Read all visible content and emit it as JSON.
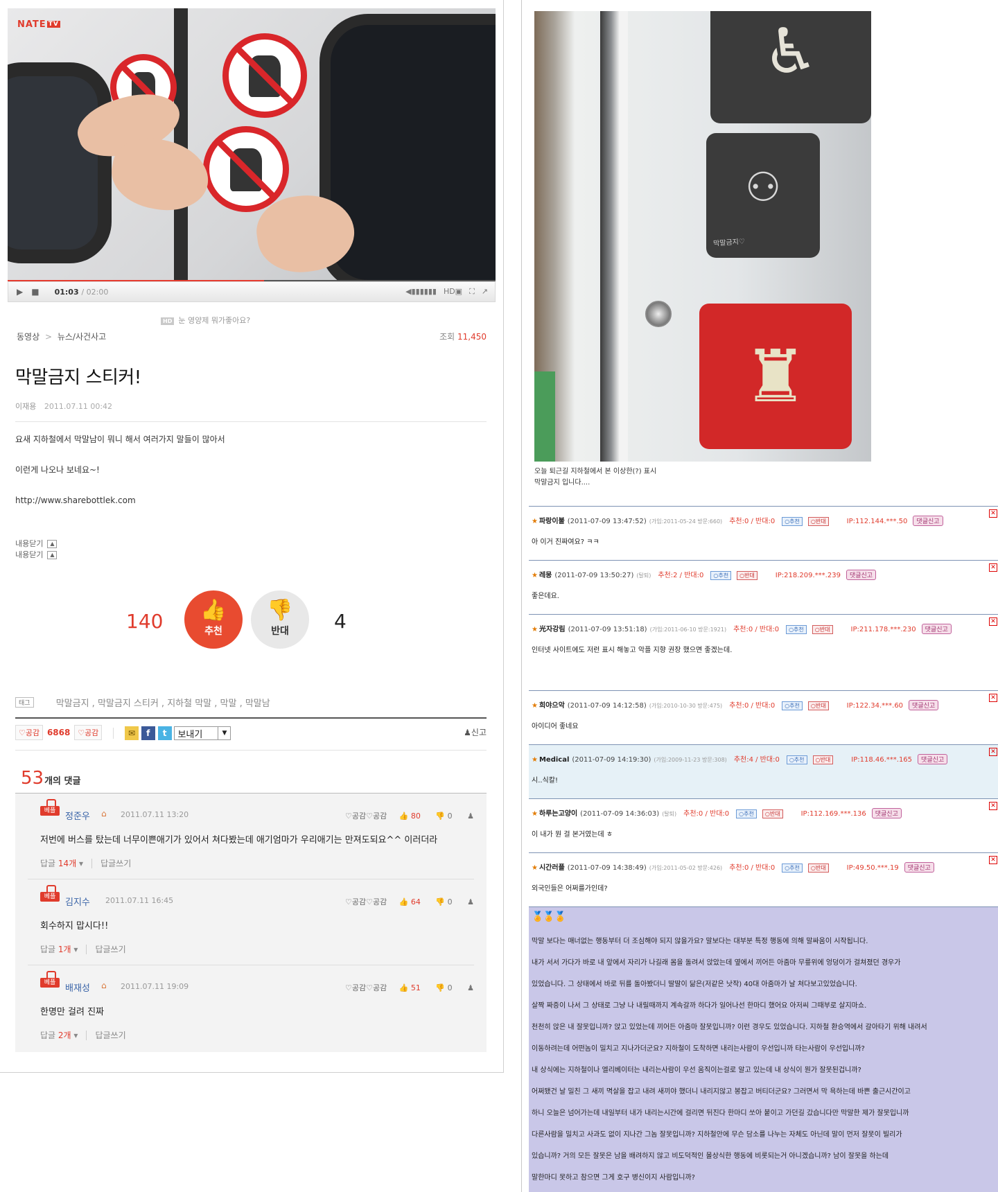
{
  "video": {
    "logo": "NATE",
    "logo_tv": "TV",
    "time_current": "01:03",
    "time_total": "/ 02:00",
    "progress": 0.525,
    "hd_badge": "HD",
    "hd_note": "눈 영양제 뭐가좋아요?"
  },
  "breadcrumb": {
    "root": "동영상",
    "separator": ">",
    "category": "뉴스/사건사고"
  },
  "views": {
    "label": "조회",
    "value": "11,450"
  },
  "post": {
    "title": "막말금지 스티커!",
    "author": "이재용",
    "date": "2011.07.11 00:42",
    "paragraphs": [
      "요새 지하철에서 막말남이 뭐니 해서 여러가지 말들이 많아서",
      "이런게 나오나 보네요~!",
      "http://www.sharebottlek.com"
    ],
    "fold_1": "내용닫기",
    "fold_2": "내용닫기"
  },
  "votes": {
    "up_count": "140",
    "up_label": "추천",
    "down_label": "반대",
    "down_count": "4"
  },
  "tags": {
    "badge": "태그",
    "text": "막말금지 , 막말금지 스티커 , 지하철 막말 , 막말 , 막말남"
  },
  "share": {
    "gong_label": "공감",
    "count": "6868",
    "gong_label_2": "공감",
    "send_label": "보내기",
    "report_label": "신고"
  },
  "comments_header": {
    "count": "53",
    "suffix": "개의 댓글"
  },
  "comments": [
    {
      "badge": "베플",
      "name": "정준우",
      "date": "2011.07.11 13:20",
      "gong1": "공감",
      "gong2": "공감",
      "up": "80",
      "down": "0",
      "text": "저번에 버스를 탔는데 너무이쁜애기가 있어서 쳐다봤는데 애기엄마가 우리애기는 만져도되요^^ 이러더라",
      "reply_label": "답글",
      "reply_count": "14개",
      "write_label": "답글쓰기"
    },
    {
      "badge": "베플",
      "name": "김지수",
      "date": "2011.07.11 16:45",
      "gong1": "공감",
      "gong2": "공감",
      "up": "64",
      "down": "0",
      "text": "회수하지 맙시다!!",
      "reply_label": "답글",
      "reply_count": "1개",
      "write_label": "답글쓰기"
    },
    {
      "badge": "베플",
      "name": "배재성",
      "date": "2011.07.11 19:09",
      "gong1": "공감",
      "gong2": "공감",
      "up": "51",
      "down": "0",
      "text": "한명만 걸려 진짜",
      "reply_label": "답글",
      "reply_count": "2개",
      "write_label": "답글쓰기"
    }
  ],
  "right_photo": {
    "sign_caption": "막말금지♡",
    "caption_line1": "오늘 퇴근길 지하철에서 본 이상한(?) 표시",
    "caption_line2": "막말금지 입니다...."
  },
  "board_comments": [
    {
      "name": "파랑이불",
      "ts": "(2011-07-09 13:47:52)",
      "meta": "(가입:2011-05-24 방문:660)",
      "score": "추천:0 / 반대:0",
      "ip": "IP:112.144.***.50",
      "btn_up": "추천",
      "btn_down": "반대",
      "report": "댓글신고",
      "text": "아 이거 진짜여요? ㅋㅋ"
    },
    {
      "name": "레몽",
      "ts": "(2011-07-09 13:50:27)",
      "meta": "(탈퇴)",
      "score": "추천:2 / 반대:0",
      "ip": "IP:218.209.***.239",
      "btn_up": "추천",
      "btn_down": "반대",
      "report": "댓글신고",
      "text": "좋은데요."
    },
    {
      "name": "光자강림",
      "ts": "(2011-07-09 13:51:18)",
      "meta": "(가입:2011-06-10 방문:1921)",
      "score": "추천:0 / 반대:0",
      "ip": "IP:211.178.***.230",
      "btn_up": "추천",
      "btn_down": "반대",
      "report": "댓글신고",
      "text": "인터넷 사이트에도 저런 표시 해놓고 악플 지향 권장 했으면 좋겠는데."
    },
    {
      "name": "희야으악",
      "ts": "(2011-07-09 14:12:58)",
      "meta": "(가입:2010-10-30 방문:475)",
      "score": "추천:0 / 반대:0",
      "ip": "IP:122.34.***.60",
      "btn_up": "추천",
      "btn_down": "반대",
      "report": "댓글신고",
      "text": "아이디어 좋네요"
    },
    {
      "name": "Medical",
      "ts": "(2011-07-09 14:19:30)",
      "meta": "(가입:2009-11-23 방문:308)",
      "score": "추천:4 / 반대:0",
      "ip": "IP:118.46.***.165",
      "btn_up": "추천",
      "btn_down": "반대",
      "report": "댓글신고",
      "text": "시..식칼!"
    },
    {
      "name": "하루는고양이",
      "ts": "(2011-07-09 14:36:03)",
      "meta": "(탈퇴)",
      "score": "추천:0 / 반대:0",
      "ip": "IP:112.169.***.136",
      "btn_up": "추천",
      "btn_down": "반대",
      "report": "댓글신고",
      "text": "이 내가 뭔 걸 본거였는데 ㅎ"
    },
    {
      "name": "시간러플",
      "ts": "(2011-07-09 14:38:49)",
      "meta": "(가입:2011-05-02 방문:426)",
      "score": "추천:0 / 반대:0",
      "ip": "IP:49.50.***.19",
      "btn_up": "추천",
      "btn_down": "반대",
      "report": "댓글신고",
      "text": "외국인들은 어쩌를가인데?"
    }
  ],
  "long_comment": {
    "lines": [
      "막말 보다는 매너없는 행동부터 더 조심해야 되지 않을가요? 말보다는 대부분 특정 행동에 의해 말싸움이 시작됩니다.",
      "내가 서서 가다가 바로 내 앞에서 자리가 나길래 몸을 돌려서 앉았는데 옆에서 끼어든 아줌마 무릎위에 엉덩이가 걸쳐졌던 경우가",
      "있었습니다. 그 상태에서 바로 뒤를 돌아봤더니 딸딸이 닮은(저같은 낫작) 40대 아줌마가 날 쳐다보고있었습니다.",
      "살짝 짜증이 나서 그 상태로 그냥 나 내릴때까지 계속갈까 하다가 일어나선 한마디 했어요 아저씨 그때부로 살지마쇼.",
      "천천히 앉은 내 잘못입니까? 앉고 있었는데 끼어든 아줌마 잘못입니까? 이런 경우도 있었습니다. 지하철 환승역에서 갈아타기 위해 내려서",
      "이동하려는데 어떤놈이 밀치고 지나가더군요? 지하철이 도착하면 내리는사람이 우선입니까 타는사람이 우선입니까?",
      "내 상식에는 지하철이나 엘리베이터는 내리는사람이 우선 움직이는걸로 알고 있는데 내 상식이 뭔가 잘못된겁니까?",
      "어쩌됐건 날 밀친 그 새끼 멱살을 잡고 내려 새끼야 했더니 내리지않고 봉잡고 버티더군요? 그러면서 막 욕하는데 바쁜 출근시간이고",
      "하니 오늘은 넘어가는데 내일부터 내가 내리는시간에 걸리면 뒤진다 한마디 쏘아 붙이고 가던길 갔습니다만 막말한 제가 잘못입니까",
      "다른사람을 밀치고 사과도 없이 지나간 그놈 잘못입니까? 지하철안에 무슨 담소를 나누는 자체도 아닌데 말이 먼저 잘못이 빌리가",
      "있습니까? 거의 모든 잘못은 남을 배려하지 않고 비도덕적인 몰상식한 행동에 비롯되는거 아니겠습니까? 남이 잘못을 하는데",
      "말한마디 못하고 참으면 그게 호구 병신이지 사람입니까?"
    ]
  }
}
